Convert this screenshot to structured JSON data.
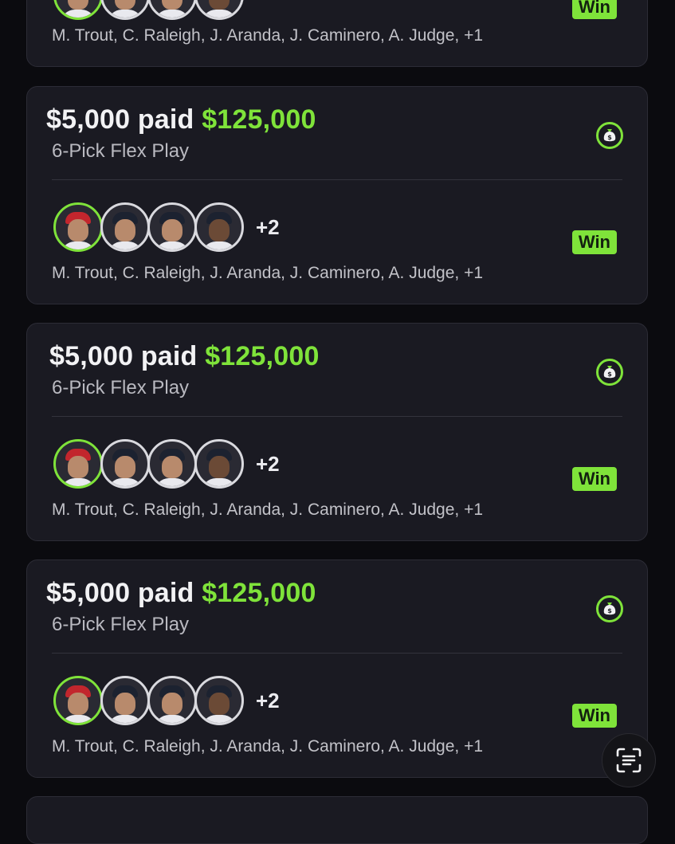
{
  "colors": {
    "background": "#0b0b0f",
    "card": "#1a1a22",
    "accent_green": "#7fe33a",
    "text_primary": "#f2f2f4",
    "text_secondary": "#b9b9c0"
  },
  "top_card": {
    "status_label": "Win",
    "players_text": "M. Trout, C. Raleigh, J. Aranda, J. Caminero, A. Judge, +1"
  },
  "cards": [
    {
      "paid_label": "$5,000 paid",
      "payout": "$125,000",
      "play_type": "6-Pick Flex Play",
      "more_count": "+2",
      "status_label": "Win",
      "players_text": "M. Trout, C. Raleigh, J. Aranda, J. Caminero, A. Judge, +1",
      "action_icon": "money-bag-icon"
    },
    {
      "paid_label": "$5,000 paid",
      "payout": "$125,000",
      "play_type": "6-Pick Flex Play",
      "more_count": "+2",
      "status_label": "Win",
      "players_text": "M. Trout, C. Raleigh, J. Aranda, J. Caminero, A. Judge, +1",
      "action_icon": "money-bag-icon"
    },
    {
      "paid_label": "$5,000 paid",
      "payout": "$125,000",
      "play_type": "6-Pick Flex Play",
      "more_count": "+2",
      "status_label": "Win",
      "players_text": "M. Trout, C. Raleigh, J. Aranda, J. Caminero, A. Judge, +1",
      "action_icon": "money-bag-icon"
    }
  ],
  "floating_button_icon": "text-scan-icon"
}
